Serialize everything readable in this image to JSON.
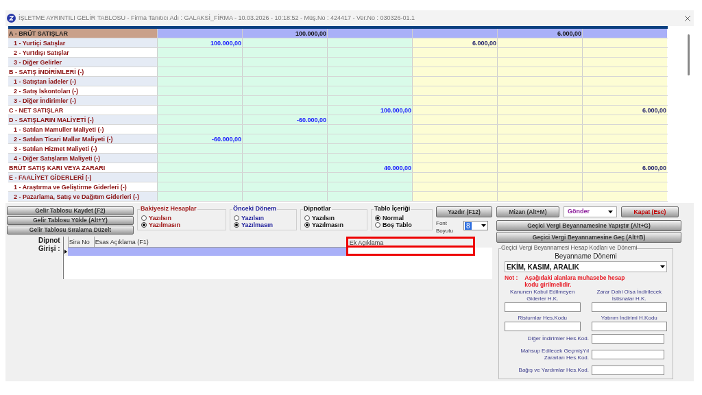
{
  "window": {
    "title": "İŞLETME AYRINTILI GELİR TABLOSU - Firma Tanıtıcı Adı : GALAKSİ_FİRMA - 10.03.2026 - 10:18:52 - Müş.No : 424417 - Ver.No : 030326-01.1"
  },
  "table": {
    "columns": [
      {
        "kind": "green"
      },
      {
        "kind": "green"
      },
      {
        "kind": "green"
      },
      {
        "kind": "yellow"
      },
      {
        "kind": "yellow"
      },
      {
        "kind": "yellow"
      }
    ],
    "rows": [
      {
        "label": "A - BRÜT SATIŞLAR",
        "kind": "section",
        "highlighted": true,
        "values": {
          "column_2": "100.000,00",
          "column_5": "6.000,00"
        }
      },
      {
        "label": "1 - Yurtiçi Satışlar",
        "kind": "item",
        "highlighted": false,
        "values": {
          "column_1": "100.000,00",
          "column_4": "6.000,00"
        }
      },
      {
        "label": "2 - Yurtdışı Satışlar",
        "kind": "item",
        "highlighted": false,
        "values": {}
      },
      {
        "label": "3 - Diğer Gelirler",
        "kind": "item",
        "highlighted": false,
        "values": {}
      },
      {
        "label": "B - SATIŞ İNDİRİMLERİ (-)",
        "kind": "section",
        "highlighted": false,
        "values": {}
      },
      {
        "label": "1 - Satıştan İadeler (-)",
        "kind": "item",
        "highlighted": false,
        "values": {}
      },
      {
        "label": "2 - Satış İskontoları (-)",
        "kind": "item",
        "highlighted": false,
        "values": {}
      },
      {
        "label": "3 - Diğer İndirimler (-)",
        "kind": "item",
        "highlighted": false,
        "values": {}
      },
      {
        "label": "C - NET SATIŞLAR",
        "kind": "section",
        "highlighted": false,
        "values": {
          "column_3": "100.000,00",
          "column_6": "6.000,00"
        }
      },
      {
        "label": "D - SATIŞLARIN MALİYETİ (-)",
        "kind": "section",
        "highlighted": false,
        "values": {
          "column_2": "-60.000,00"
        }
      },
      {
        "label": "1 - Satılan Mamuller Maliyeti (-)",
        "kind": "item",
        "highlighted": false,
        "values": {}
      },
      {
        "label": "2 - Satılan Ticari Mallar Maliyeti (-)",
        "kind": "item",
        "highlighted": false,
        "values": {
          "column_1": "-60.000,00"
        }
      },
      {
        "label": "3 - Satılan Hizmet Maliyeti (-)",
        "kind": "item",
        "highlighted": false,
        "values": {}
      },
      {
        "label": "4 - Diğer Satışların Maliyeti (-)",
        "kind": "item",
        "highlighted": false,
        "values": {}
      },
      {
        "label": "BRÜT SATIŞ KARI VEYA ZARARI",
        "kind": "section",
        "highlighted": false,
        "values": {
          "column_3": "40.000,00",
          "column_6": "6.000,00"
        }
      },
      {
        "label": "E - FAALİYET GİDERLERİ (-)",
        "kind": "section",
        "highlighted": false,
        "values": {}
      },
      {
        "label": "1 - Araştırma ve Geliştirme Giderleri (-)",
        "kind": "item",
        "highlighted": false,
        "values": {}
      },
      {
        "label": "2 - Pazarlama, Satış ve Dağıtım Giderleri (-)",
        "kind": "item",
        "highlighted": false,
        "values": {}
      }
    ]
  },
  "left_buttons": [
    "Gelir Tablosu Kaydet (F2)",
    "Gelir Tablosu Yükle (Alt+Y)",
    "Gelir Tablosu Sıralama Düzelt"
  ],
  "option_groups": [
    {
      "title": "Bakiyesiz Hesaplar",
      "color": "#a01818",
      "options": [
        {
          "label": "Yazılsın",
          "selected": false
        },
        {
          "label": "Yazılmasın",
          "selected": true
        }
      ]
    },
    {
      "title": "Önceki Dönem",
      "color": "#1a1a9a",
      "options": [
        {
          "label": "Yazılsın",
          "selected": false
        },
        {
          "label": "Yazılmasın",
          "selected": true
        }
      ]
    },
    {
      "title": "Dipnotlar",
      "color": "#111111",
      "options": [
        {
          "label": "Yazılsın",
          "selected": false
        },
        {
          "label": "Yazılmasın",
          "selected": true
        }
      ]
    },
    {
      "title": "Tablo İçeriği",
      "color": "#111111",
      "options": [
        {
          "label": "Normal",
          "selected": true
        },
        {
          "label": "Boş Tablo",
          "selected": false
        }
      ]
    }
  ],
  "print_button": "Yazdır (F12)",
  "font_size": {
    "label": "Font Boyutu",
    "value": "8"
  },
  "right_buttons": [
    {
      "label": "Mizan (Alt+M)",
      "kind": "button",
      "color": "#3a3a3a"
    },
    {
      "label": "Gönder",
      "kind": "dropdown",
      "color": "#8a1a9a"
    },
    {
      "label": "Kapat (Esc)",
      "kind": "button",
      "color": "#c00000"
    }
  ],
  "wide_buttons": [
    "Geçici Vergi Beyannamesine Yapıştır  (Alt+G)",
    "Geçici Vergi Beyannamesine Geç (Alt+B)"
  ],
  "footnote": {
    "label": "Dipnot Girişi :",
    "columns": [
      {
        "label": "Sira No",
        "highlighted": false
      },
      {
        "label": "Esas Açıklama (F1)",
        "highlighted": false
      },
      {
        "label": "Ek Açıklama",
        "highlighted": true
      }
    ]
  },
  "tax_panel": {
    "legend": "Geçici Vergi Beyannamesi Hesap Kodları ve Dönemi",
    "period_label": "Beyanname Dönemi",
    "period_value": "EKİM, KASIM, ARALIK",
    "note_label": "Not :",
    "note": "Aşağıdaki alanlara muhasebe hesap kodu girilmelidir.",
    "fields": [
      {
        "label": "Kanunen Kabul Edilmeyen Giderler H.K.",
        "kind": "stacked"
      },
      {
        "label": "Zarar Dahi Olsa İndirilecek İstisnalar H.K.",
        "kind": "stacked"
      },
      {
        "label": "Risturnlar Hes.Kodu",
        "kind": "stacked"
      },
      {
        "label": "Yatırım İndirimi H.Kodu",
        "kind": "stacked"
      },
      {
        "label": "Diğer İndirimler Hes.Kod.",
        "kind": "inline"
      },
      {
        "label": "Mahsup Edilecek GeçmişYıl Zararları Hes.Kod.",
        "kind": "inline"
      },
      {
        "label": "Bağış ve Yardımlar Hes.Kod.",
        "kind": "inline"
      }
    ]
  }
}
